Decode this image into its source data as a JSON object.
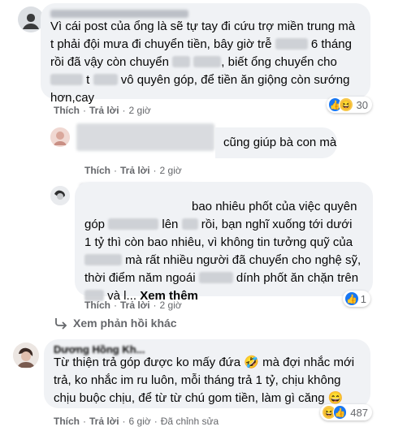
{
  "comments": [
    {
      "text_lines": [
        "Vì cái post của ổng là sẽ tự tay đi cứu trợ miền trung mà",
        "t phải đội mưa đi chuyển tiền, bây giờ trễ",
        "6 tháng",
        "rồi đã vậy còn chuyển",
        ", biết ổng chuyển cho",
        "t",
        "vô quyên góp, để tiền ăn giộng còn sướng",
        "hơn,cay"
      ],
      "actions": {
        "like": "Thích",
        "reply": "Trả lời",
        "time": "2 giờ"
      },
      "reactions": {
        "count": "30"
      }
    },
    {
      "text_lines": [
        "cũng giúp bà con mà"
      ],
      "actions": {
        "like": "Thích",
        "reply": "Trả lời",
        "time": "2 giờ"
      }
    },
    {
      "text_lines": [
        "bao nhiêu phốt của việc quyên",
        "góp",
        "lên",
        "rồi, bạn nghĩ xuống tới dưới",
        "1 tỷ thì còn bao nhiêu, vì không tin tưởng quỹ của",
        "mà rất nhiều người đã chuyển cho nghệ sỹ,",
        "thời điểm năm ngoái",
        "dính phốt ăn chặn trên",
        "và l...",
        "Xem thêm"
      ],
      "actions": {
        "like": "Thích",
        "reply": "Trả lời",
        "time": "2 giờ"
      },
      "reactions": {
        "count": "1"
      }
    },
    {
      "name": "Dương Hồng Kh...",
      "text_lines": [
        "Từ thiện trả góp được ko mấy đứa",
        "mà đợi nhắc mới",
        "trả, ko nhắc im ru luôn, mỗi tháng trả 1 tỷ, chịu không",
        "chịu buộc chịu, để từ từ chú gom tiền, làm gì căng"
      ],
      "emoji_inline_1": "🤣",
      "emoji_inline_2": "😄",
      "actions": {
        "like": "Thích",
        "reply": "Trả lời",
        "time": "6 giờ",
        "edited": "Đã chỉnh sửa"
      },
      "reactions": {
        "count": "487"
      }
    }
  ],
  "more_replies": "Xem phản hồi khác",
  "icons": {
    "like": "👍",
    "haha": "😆"
  }
}
